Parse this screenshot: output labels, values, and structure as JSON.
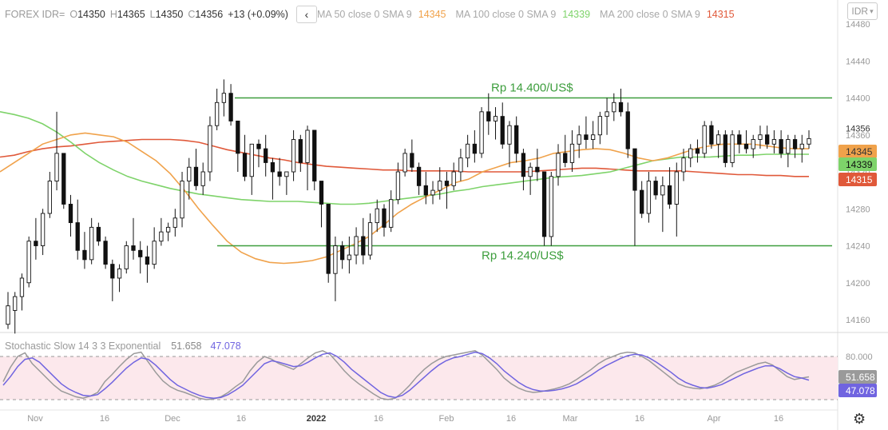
{
  "header": {
    "symbol": "FOREX IDR=",
    "o_label": "O",
    "o_value": "14350",
    "h_label": "H",
    "h_value": "14365",
    "l_label": "L",
    "l_value": "14350",
    "c_label": "C",
    "c_value": "14356",
    "change": "+13 (+0.09%)",
    "ma50_label": "MA 50 close 0 SMA 9",
    "ma50_value": "14345",
    "ma100_label": "MA 100 close 0 SMA 9",
    "ma100_value": "14339",
    "ma200_label": "MA 200 close 0 SMA 9",
    "ma200_value": "14315"
  },
  "currency_label": "IDR",
  "colors": {
    "ma50": "#f0a24b",
    "ma100": "#7ed36a",
    "ma200": "#e0593a",
    "level_line": "#3e9e3e",
    "stoch_k": "#9a9a9a",
    "stoch_d": "#7064e0",
    "stoch_band": "#fce8ec"
  },
  "chart_data": {
    "type": "candlestick",
    "title": "",
    "ylim": [
      14135,
      14495
    ],
    "y_ticks": [
      "14480",
      "14440",
      "14400",
      "14360",
      "14320",
      "14280",
      "14240",
      "14200",
      "14160"
    ],
    "x_ticks": [
      "Nov",
      "16",
      "Dec",
      "16",
      "2022",
      "16",
      "Feb",
      "16",
      "Mar",
      "16",
      "Apr",
      "16"
    ],
    "price_label": "14356",
    "ma_labels": [
      "14345",
      "14339",
      "14315"
    ],
    "levels": [
      {
        "value": 14400,
        "label": "Rp 14.400/US$"
      },
      {
        "value": 14240,
        "label": "Rp 14.240/US$"
      }
    ],
    "candles": [
      [
        14155,
        14190,
        14150,
        14175
      ],
      [
        14170,
        14190,
        14145,
        14185
      ],
      [
        14185,
        14210,
        14170,
        14205
      ],
      [
        14200,
        14250,
        14195,
        14245
      ],
      [
        14245,
        14270,
        14225,
        14240
      ],
      [
        14240,
        14280,
        14230,
        14275
      ],
      [
        14275,
        14320,
        14270,
        14310
      ],
      [
        14310,
        14385,
        14300,
        14340
      ],
      [
        14340,
        14330,
        14280,
        14285
      ],
      [
        14285,
        14295,
        14250,
        14265
      ],
      [
        14265,
        14290,
        14225,
        14235
      ],
      [
        14235,
        14255,
        14215,
        14225
      ],
      [
        14225,
        14270,
        14220,
        14260
      ],
      [
        14260,
        14265,
        14240,
        14245
      ],
      [
        14245,
        14250,
        14215,
        14220
      ],
      [
        14220,
        14225,
        14180,
        14205
      ],
      [
        14205,
        14220,
        14190,
        14215
      ],
      [
        14215,
        14245,
        14210,
        14240
      ],
      [
        14240,
        14270,
        14225,
        14235
      ],
      [
        14235,
        14245,
        14210,
        14228
      ],
      [
        14228,
        14240,
        14200,
        14220
      ],
      [
        14220,
        14260,
        14215,
        14245
      ],
      [
        14245,
        14270,
        14240,
        14255
      ],
      [
        14255,
        14265,
        14245,
        14260
      ],
      [
        14260,
        14280,
        14250,
        14270
      ],
      [
        14270,
        14320,
        14260,
        14310
      ],
      [
        14310,
        14335,
        14290,
        14325
      ],
      [
        14325,
        14345,
        14300,
        14305
      ],
      [
        14305,
        14330,
        14295,
        14320
      ],
      [
        14320,
        14380,
        14310,
        14370
      ],
      [
        14370,
        14410,
        14365,
        14395
      ],
      [
        14395,
        14420,
        14380,
        14405
      ],
      [
        14405,
        14415,
        14370,
        14375
      ],
      [
        14375,
        14370,
        14320,
        14340
      ],
      [
        14340,
        14360,
        14310,
        14315
      ],
      [
        14315,
        14345,
        14295,
        14350
      ],
      [
        14350,
        14355,
        14325,
        14345
      ],
      [
        14345,
        14360,
        14315,
        14330
      ],
      [
        14330,
        14335,
        14290,
        14320
      ],
      [
        14320,
        14335,
        14305,
        14315
      ],
      [
        14315,
        14320,
        14295,
        14320
      ],
      [
        14320,
        14365,
        14310,
        14355
      ],
      [
        14355,
        14360,
        14320,
        14330
      ],
      [
        14330,
        14370,
        14300,
        14365
      ],
      [
        14365,
        14360,
        14300,
        14310
      ],
      [
        14310,
        14305,
        14260,
        14285
      ],
      [
        14285,
        14270,
        14200,
        14210
      ],
      [
        14210,
        14250,
        14180,
        14240
      ],
      [
        14240,
        14245,
        14215,
        14225
      ],
      [
        14225,
        14250,
        14210,
        14230
      ],
      [
        14230,
        14260,
        14220,
        14250
      ],
      [
        14250,
        14270,
        14220,
        14230
      ],
      [
        14230,
        14275,
        14225,
        14265
      ],
      [
        14265,
        14290,
        14255,
        14280
      ],
      [
        14280,
        14285,
        14250,
        14260
      ],
      [
        14260,
        14300,
        14255,
        14290
      ],
      [
        14290,
        14330,
        14285,
        14320
      ],
      [
        14320,
        14345,
        14315,
        14340
      ],
      [
        14340,
        14355,
        14320,
        14325
      ],
      [
        14325,
        14330,
        14295,
        14305
      ],
      [
        14305,
        14320,
        14285,
        14295
      ],
      [
        14295,
        14310,
        14285,
        14300
      ],
      [
        14300,
        14325,
        14290,
        14310
      ],
      [
        14310,
        14320,
        14280,
        14305
      ],
      [
        14305,
        14330,
        14300,
        14320
      ],
      [
        14320,
        14345,
        14310,
        14335
      ],
      [
        14335,
        14360,
        14325,
        14350
      ],
      [
        14350,
        14365,
        14330,
        14340
      ],
      [
        14340,
        14390,
        14335,
        14385
      ],
      [
        14385,
        14405,
        14360,
        14375
      ],
      [
        14375,
        14390,
        14355,
        14380
      ],
      [
        14380,
        14395,
        14345,
        14350
      ],
      [
        14350,
        14375,
        14325,
        14370
      ],
      [
        14370,
        14380,
        14330,
        14340
      ],
      [
        14340,
        14345,
        14300,
        14315
      ],
      [
        14315,
        14330,
        14295,
        14325
      ],
      [
        14325,
        14345,
        14310,
        14320
      ],
      [
        14320,
        14290,
        14240,
        14250
      ],
      [
        14250,
        14320,
        14240,
        14315
      ],
      [
        14315,
        14350,
        14305,
        14340
      ],
      [
        14340,
        14360,
        14325,
        14330
      ],
      [
        14330,
        14365,
        14320,
        14350
      ],
      [
        14350,
        14370,
        14335,
        14360
      ],
      [
        14360,
        14380,
        14345,
        14355
      ],
      [
        14355,
        14375,
        14345,
        14360
      ],
      [
        14360,
        14385,
        14350,
        14380
      ],
      [
        14380,
        14400,
        14360,
        14385
      ],
      [
        14385,
        14405,
        14375,
        14395
      ],
      [
        14395,
        14410,
        14380,
        14385
      ],
      [
        14385,
        14395,
        14335,
        14345
      ],
      [
        14345,
        14335,
        14240,
        14300
      ],
      [
        14300,
        14310,
        14270,
        14275
      ],
      [
        14275,
        14320,
        14265,
        14310
      ],
      [
        14310,
        14315,
        14290,
        14295
      ],
      [
        14295,
        14315,
        14255,
        14305
      ],
      [
        14305,
        14325,
        14280,
        14285
      ],
      [
        14285,
        14330,
        14250,
        14320
      ],
      [
        14320,
        14345,
        14310,
        14335
      ],
      [
        14335,
        14350,
        14325,
        14345
      ],
      [
        14345,
        14355,
        14330,
        14340
      ],
      [
        14340,
        14375,
        14335,
        14370
      ],
      [
        14370,
        14375,
        14345,
        14350
      ],
      [
        14350,
        14365,
        14335,
        14360
      ],
      [
        14360,
        14365,
        14325,
        14330
      ],
      [
        14330,
        14365,
        14325,
        14360
      ],
      [
        14360,
        14365,
        14340,
        14350
      ],
      [
        14350,
        14365,
        14340,
        14345
      ],
      [
        14345,
        14360,
        14335,
        14355
      ],
      [
        14355,
        14370,
        14345,
        14360
      ],
      [
        14360,
        14370,
        14345,
        14350
      ],
      [
        14350,
        14365,
        14340,
        14355
      ],
      [
        14355,
        14365,
        14335,
        14340
      ],
      [
        14340,
        14360,
        14325,
        14355
      ],
      [
        14355,
        14360,
        14335,
        14345
      ],
      [
        14345,
        14360,
        14330,
        14350
      ],
      [
        14350,
        14365,
        14345,
        14356
      ]
    ],
    "ma50": [
      14320,
      14330,
      14340,
      14350,
      14355,
      14360,
      14362,
      14360,
      14358,
      14352,
      14342,
      14332,
      14318,
      14300,
      14280,
      14262,
      14245,
      14233,
      14226,
      14222,
      14221,
      14222,
      14224,
      14228,
      14235,
      14242,
      14250,
      14262,
      14275,
      14285,
      14293,
      14300,
      14308,
      14312,
      14320,
      14325,
      14330,
      14332,
      14335,
      14340,
      14342,
      14344,
      14345,
      14344,
      14340,
      14335,
      14332,
      14335,
      14340,
      14345,
      14348,
      14350,
      14350,
      14350,
      14348,
      14346,
      14345,
      14345
    ],
    "ma100": [
      14385,
      14382,
      14378,
      14372,
      14363,
      14352,
      14340,
      14330,
      14322,
      14315,
      14310,
      14306,
      14302,
      14299,
      14296,
      14294,
      14292,
      14290,
      14289,
      14288,
      14288,
      14288,
      14287,
      14286,
      14285,
      14285,
      14286,
      14288,
      14290,
      14292,
      14294,
      14296,
      14299,
      14301,
      14304,
      14306,
      14308,
      14310,
      14312,
      14314,
      14315,
      14316,
      14318,
      14320,
      14324,
      14328,
      14332,
      14334,
      14336,
      14336,
      14336,
      14337,
      14338,
      14338,
      14339,
      14339,
      14339,
      14339
    ],
    "ma200": [
      14336,
      14338,
      14342,
      14345,
      14347,
      14348,
      14350,
      14352,
      14353,
      14354,
      14355,
      14355,
      14355,
      14354,
      14352,
      14348,
      14344,
      14341,
      14338,
      14335,
      14333,
      14330,
      14328,
      14326,
      14325,
      14324,
      14323,
      14322,
      14322,
      14321,
      14321,
      14321,
      14321,
      14320,
      14320,
      14320,
      14320,
      14320,
      14321,
      14322,
      14323,
      14324,
      14324,
      14323,
      14322,
      14321,
      14321,
      14321,
      14321,
      14320,
      14319,
      14318,
      14317,
      14317,
      14316,
      14316,
      14315,
      14315
    ]
  },
  "stoch": {
    "label": "Stochastic Slow 14 3 3 Exponential",
    "k_value": "51.658",
    "d_value": "47.078",
    "level_high_label": "80.000",
    "range": [
      0,
      100
    ],
    "upper_band": 80,
    "lower_band": 20,
    "k": [
      45,
      65,
      80,
      85,
      70,
      60,
      50,
      40,
      32,
      28,
      24,
      22,
      25,
      30,
      45,
      55,
      66,
      76,
      84,
      86,
      72,
      58,
      46,
      38,
      33,
      30,
      26,
      22,
      20,
      21,
      24,
      30,
      38,
      45,
      60,
      72,
      80,
      76,
      70,
      66,
      62,
      70,
      78,
      85,
      88,
      83,
      72,
      60,
      50,
      42,
      35,
      28,
      22,
      20,
      22,
      30,
      40,
      52,
      62,
      70,
      76,
      80,
      82,
      84,
      86,
      88,
      82,
      72,
      62,
      50,
      42,
      36,
      32,
      30,
      31,
      33,
      35,
      38,
      42,
      48,
      55,
      62,
      70,
      76,
      80,
      84,
      86,
      85,
      80,
      74,
      66,
      58,
      50,
      42,
      38,
      36,
      35,
      37,
      40,
      45,
      52,
      58,
      62,
      66,
      70,
      72,
      68,
      60,
      52,
      48,
      50,
      51.658
    ],
    "d": [
      40,
      52,
      66,
      76,
      78,
      72,
      62,
      52,
      42,
      35,
      30,
      26,
      25,
      27,
      35,
      44,
      54,
      64,
      72,
      78,
      76,
      68,
      58,
      48,
      40,
      35,
      30,
      26,
      23,
      22,
      23,
      27,
      33,
      40,
      50,
      60,
      70,
      74,
      72,
      69,
      66,
      67,
      72,
      78,
      83,
      85,
      80,
      72,
      62,
      54,
      46,
      38,
      30,
      25,
      23,
      26,
      33,
      42,
      51,
      60,
      68,
      74,
      78,
      80,
      83,
      86,
      84,
      78,
      70,
      60,
      52,
      44,
      38,
      34,
      32,
      32,
      33,
      35,
      38,
      42,
      48,
      54,
      61,
      67,
      72,
      77,
      81,
      83,
      82,
      78,
      72,
      65,
      58,
      50,
      44,
      40,
      37,
      36,
      38,
      41,
      46,
      51,
      56,
      60,
      64,
      67,
      67,
      63,
      57,
      52,
      50,
      47.078
    ]
  },
  "stoch_k_color": "#9a9a9a",
  "stoch_d_color": "#7064e0"
}
